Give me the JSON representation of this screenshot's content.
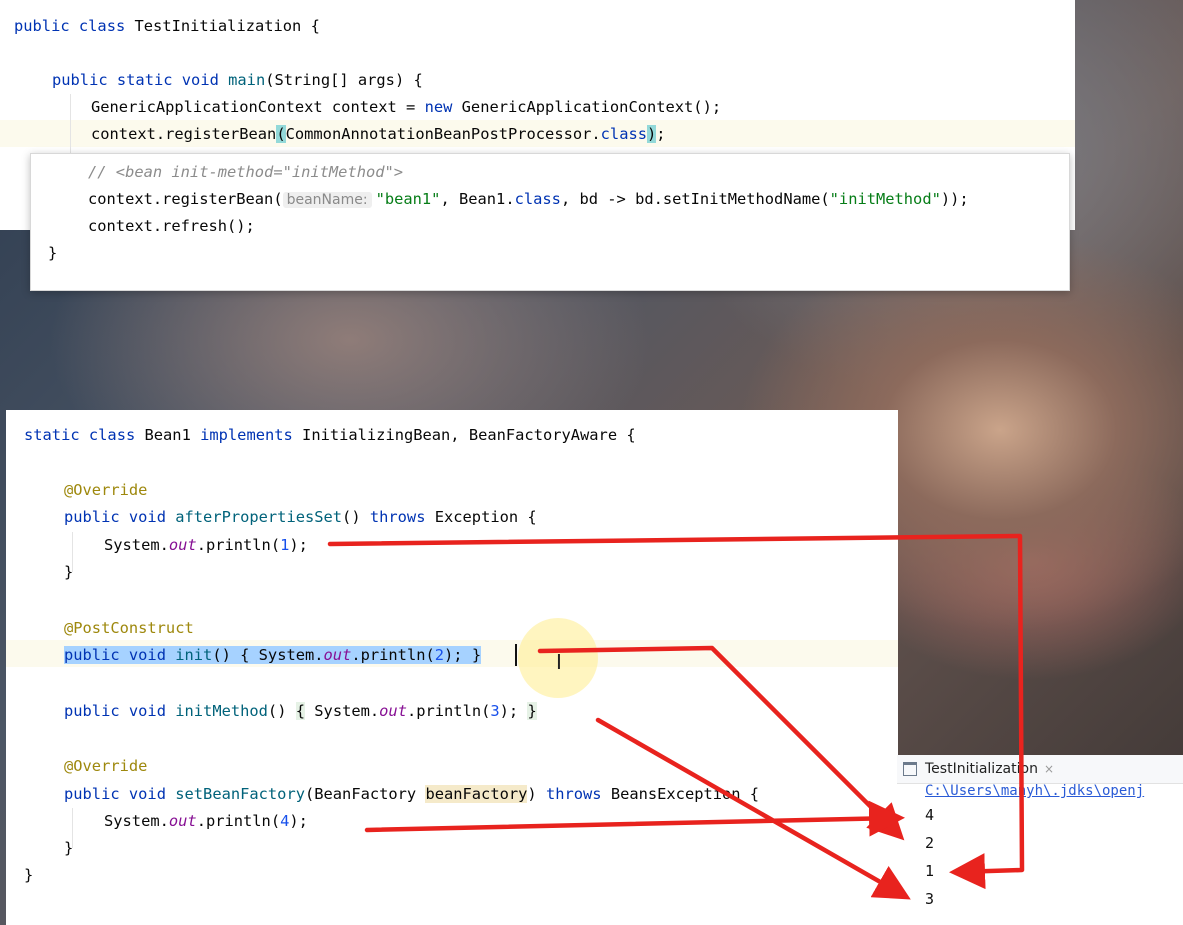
{
  "top_code": {
    "line1": {
      "kw1": "public",
      "kw2": "class",
      "name": "TestInitialization",
      "brace": " {"
    },
    "line2": {
      "kw1": "public",
      "kw2": "static",
      "kw3": "void",
      "fn": "main",
      "args": "(String[] args) {"
    },
    "line3": {
      "a": "GenericApplicationContext context = ",
      "kw": "new",
      "b": " GenericApplicationContext();"
    },
    "line4": {
      "a": "context.registerBean",
      "p1": "(",
      "b": "CommonAnnotationBeanPostProcessor.",
      "kw": "class",
      "p2": ")",
      ";": ";"
    }
  },
  "popup_code": {
    "comment": "// <bean init-method=\"initMethod\">",
    "line2": {
      "a": "context.registerBean(",
      "hint": "beanName:",
      "str1": "\"bean1\"",
      "b": ", Bean1.",
      "kw": "class",
      "c": ", bd -> bd.setInitMethodName(",
      "str2": "\"initMethod\"",
      "d": "));"
    },
    "line3": "context.refresh();",
    "line4": "}"
  },
  "bottom_code": {
    "l1": {
      "kw1": "static",
      "kw2": "class",
      "name": " Bean1 ",
      "kw3": "implements",
      "rest": " InitializingBean, BeanFactoryAware {"
    },
    "ann1": "@Override",
    "l3": {
      "kw1": "public",
      "kw2": "void",
      "fn": "afterPropertiesSet",
      "b": "() ",
      "kw3": "throws",
      "c": " Exception {"
    },
    "l4": {
      "a": "System.",
      "st": "out",
      "b": ".println(",
      "num": "1",
      "c": ");"
    },
    "l5": "}",
    "ann2": "@PostConstruct",
    "l7": {
      "kw1": "public",
      "kw2": "void",
      "fn": "init",
      "b": "() { System.",
      "st": "out",
      "c": ".println(",
      "num": "2",
      "d": "); }"
    },
    "l8": {
      "kw1": "public",
      "kw2": "void",
      "fn": "initMethod",
      "b": "() ",
      "br1": "{",
      "c": " System.",
      "st": "out",
      "d": ".println(",
      "num": "3",
      "e": "); ",
      "br2": "}"
    },
    "ann3": "@Override",
    "l10": {
      "kw1": "public",
      "kw2": "void",
      "fn": "setBeanFactory",
      "b": "(BeanFactory ",
      "param": "beanFactory",
      "c": ") ",
      "kw3": "throws",
      "d": " BeansException {"
    },
    "l11": {
      "a": "System.",
      "st": "out",
      "b": ".println(",
      "num": "4",
      "c": ");"
    },
    "l12": "}",
    "l13": "}"
  },
  "run_panel": {
    "tab_label": "TestInitialization",
    "close_glyph": "×",
    "path": "C:\\Users\\manyh\\.jdks\\openj",
    "output": [
      "4",
      "2",
      "1",
      "3"
    ]
  },
  "colors": {
    "arrow": "#e8231e",
    "keyword": "#0033b3",
    "selection": "#a6d2ff"
  }
}
